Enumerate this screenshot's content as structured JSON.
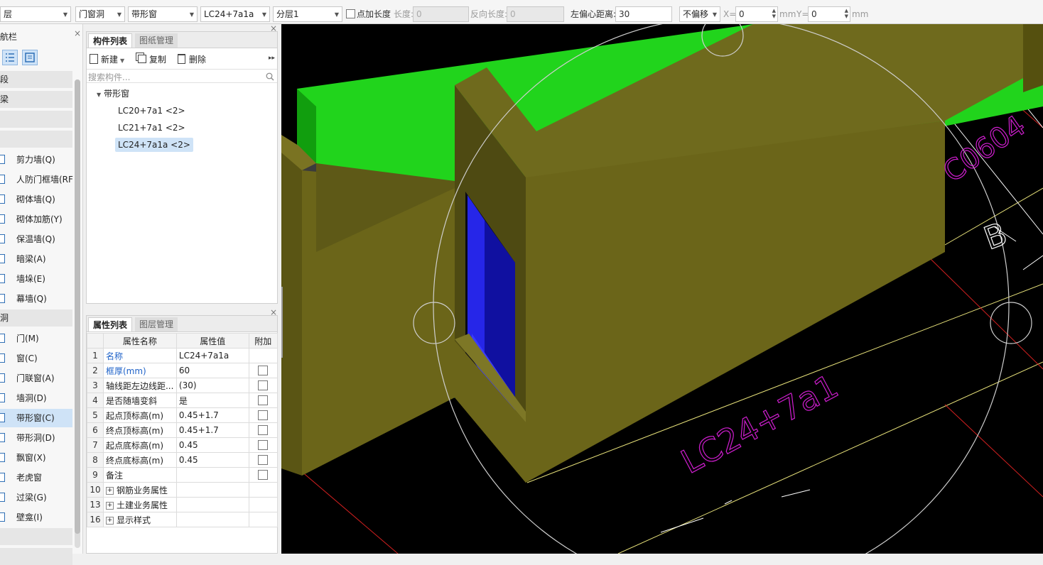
{
  "toolbar": {
    "floor_combo": "层",
    "category_combo": "门窗洞",
    "type_combo": "带形窗",
    "component_combo": "LC24+7a1a",
    "layer_combo": "分层1",
    "point_length_label": "点加长度",
    "length_label": "长度:",
    "length_value": "0",
    "reverse_length_label": "反向长度:",
    "reverse_length_value": "0",
    "left_offset_label": "左偏心距离:",
    "left_offset_value": "30",
    "offset_mode": "不偏移",
    "x_label": "X=",
    "x_value": "0",
    "mm1": "mm",
    "y_label": "Y=",
    "y_value": "0",
    "mm2": "mm"
  },
  "leftnav": {
    "title": "航栏",
    "cat1": "段",
    "cat2": "梁",
    "items_wall": [
      {
        "label": "剪力墙(Q)"
      },
      {
        "label": "人防门框墙(RF"
      },
      {
        "label": "砌体墙(Q)"
      },
      {
        "label": "砌体加筋(Y)"
      },
      {
        "label": "保温墙(Q)"
      },
      {
        "label": "暗梁(A)"
      },
      {
        "label": "墙垛(E)"
      },
      {
        "label": "幕墙(Q)"
      }
    ],
    "cat_openings": "洞",
    "items_openings": [
      {
        "label": "门(M)"
      },
      {
        "label": "窗(C)"
      },
      {
        "label": "门联窗(A)"
      },
      {
        "label": "墙洞(D)"
      },
      {
        "label": "带形窗(C)"
      },
      {
        "label": "带形洞(D)"
      },
      {
        "label": "飘窗(X)"
      },
      {
        "label": "老虎窗"
      },
      {
        "label": "过梁(G)"
      },
      {
        "label": "壁龛(I)"
      }
    ]
  },
  "components": {
    "tab_list": "构件列表",
    "tab_drawings": "图纸管理",
    "new_label": "新建",
    "copy_label": "复制",
    "delete_label": "删除",
    "search_placeholder": "搜索构件...",
    "tree_root": "带形窗",
    "tree_items": [
      "LC20+7a1 <2>",
      "LC21+7a1 <2>",
      "LC24+7a1a <2>"
    ]
  },
  "properties": {
    "tab_props": "属性列表",
    "tab_layers": "图层管理",
    "col_name": "属性名称",
    "col_value": "属性值",
    "col_extra": "附加",
    "rows": [
      {
        "num": "1",
        "name": "名称",
        "value": "LC24+7a1a"
      },
      {
        "num": "2",
        "name": "框厚(mm)",
        "value": "60"
      },
      {
        "num": "3",
        "name": "轴线距左边线距...",
        "value": "(30)"
      },
      {
        "num": "4",
        "name": "是否随墙变斜",
        "value": "是"
      },
      {
        "num": "5",
        "name": "起点顶标高(m)",
        "value": "0.45+1.7"
      },
      {
        "num": "6",
        "name": "终点顶标高(m)",
        "value": "0.45+1.7"
      },
      {
        "num": "7",
        "name": "起点底标高(m)",
        "value": "0.45"
      },
      {
        "num": "8",
        "name": "终点底标高(m)",
        "value": "0.45"
      },
      {
        "num": "9",
        "name": "备注",
        "value": ""
      },
      {
        "num": "10",
        "name": "钢筋业务属性",
        "value": ""
      },
      {
        "num": "13",
        "name": "土建业务属性",
        "value": ""
      },
      {
        "num": "16",
        "name": "显示样式",
        "value": ""
      }
    ]
  },
  "viewport": {
    "label_window": "LC24+7a1",
    "label_other": "C0604",
    "label_axis": "B"
  },
  "colors": {
    "wall": "#6b6519",
    "wall_dark": "#4e4a12",
    "slab_green": "#21d41c",
    "window_blue": "#1a1ad8",
    "magenta": "#d21ed2",
    "selection": "#cfe3f7"
  }
}
